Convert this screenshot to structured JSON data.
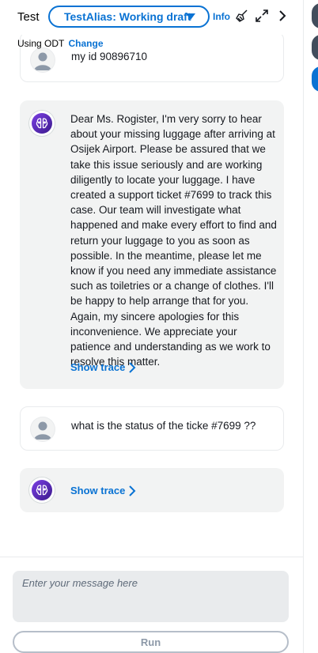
{
  "header": {
    "title": "Test",
    "alias_label": "TestAlias: Working draft",
    "info_label": "Info"
  },
  "subheader": {
    "prefix": "Using ODT",
    "change_label": "Change"
  },
  "messages": [
    {
      "role": "user",
      "text": "my id 90896710"
    },
    {
      "role": "assistant",
      "text": "Dear Ms. Rogister, I'm very sorry to hear about your missing luggage after arriving at Osijek Airport. Please be assured that we take this issue seriously and are working diligently to locate your luggage. I have created a support ticket #7699 to track this case. Our team will investigate what happened and make every effort to find and return your luggage to you as soon as possible. In the meantime, please let me know if you need any immediate assistance such as toiletries or a change of clothes. I'll be happy to help arrange that for you. Again, my sincere apologies for this inconvenience. We appreciate your patience and understanding as we work to resolve this matter.",
      "trace_label": "Show trace"
    },
    {
      "role": "user",
      "text": "what is the status of the ticke #7699 ??"
    },
    {
      "role": "assistant",
      "text": "",
      "trace_label": "Show trace"
    }
  ],
  "composer": {
    "placeholder": "Enter your message here",
    "run_label": "Run"
  },
  "colors": {
    "accent": "#0972d3",
    "bot_bubble": "#f2f3f3",
    "rail_button": "#414d5c",
    "rail_button_active": "#0972d3"
  },
  "icons": {
    "dropdown": "caret-down-icon",
    "clear": "broom-icon",
    "expand": "expand-icon",
    "collapse": "chevron-right-icon",
    "user_avatar": "user-avatar-icon",
    "bot_avatar": "brain-icon"
  }
}
